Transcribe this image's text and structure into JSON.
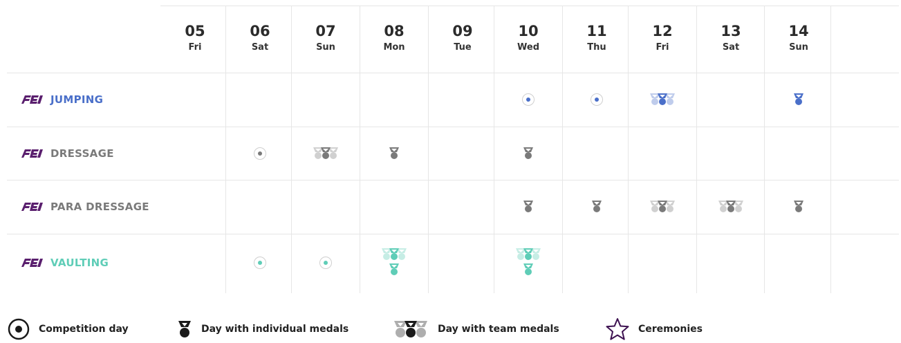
{
  "days": [
    {
      "num": "05",
      "name": "Fri"
    },
    {
      "num": "06",
      "name": "Sat"
    },
    {
      "num": "07",
      "name": "Sun"
    },
    {
      "num": "08",
      "name": "Mon"
    },
    {
      "num": "09",
      "name": "Tue"
    },
    {
      "num": "10",
      "name": "Wed"
    },
    {
      "num": "11",
      "name": "Thu"
    },
    {
      "num": "12",
      "name": "Fri"
    },
    {
      "num": "13",
      "name": "Sat"
    },
    {
      "num": "14",
      "name": "Sun"
    }
  ],
  "disciplines": [
    {
      "logo": "FEI",
      "name": "JUMPING",
      "color": "#4a6fc9",
      "events": [
        {
          "day": "10",
          "type": "competition"
        },
        {
          "day": "11",
          "type": "competition"
        },
        {
          "day": "12",
          "type": "team"
        },
        {
          "day": "14",
          "type": "individual"
        }
      ]
    },
    {
      "logo": "FEI",
      "name": "DRESSAGE",
      "color": "#7a7a7a",
      "events": [
        {
          "day": "06",
          "type": "competition"
        },
        {
          "day": "07",
          "type": "team"
        },
        {
          "day": "08",
          "type": "individual"
        },
        {
          "day": "10",
          "type": "individual"
        }
      ]
    },
    {
      "logo": "FEI",
      "name": "PARA DRESSAGE",
      "color": "#7a7a7a",
      "events": [
        {
          "day": "10",
          "type": "individual"
        },
        {
          "day": "11",
          "type": "individual"
        },
        {
          "day": "12",
          "type": "team"
        },
        {
          "day": "13",
          "type": "team"
        },
        {
          "day": "14",
          "type": "individual"
        }
      ]
    },
    {
      "logo": "FEI",
      "name": "VAULTING",
      "color": "#5fcdb7",
      "events": [
        {
          "day": "06",
          "type": "competition"
        },
        {
          "day": "07",
          "type": "competition"
        },
        {
          "day": "08",
          "type": "team+individual"
        },
        {
          "day": "10",
          "type": "team+individual"
        }
      ]
    }
  ],
  "legend": {
    "competition": "Competition day",
    "individual": "Day with individual medals",
    "team": "Day with team medals",
    "ceremonies": "Ceremonies"
  },
  "colors": {
    "fei_logo": "#5a1f6e",
    "ceremony_star": "#3d1150",
    "legend_medal": "#1a1a1a"
  }
}
